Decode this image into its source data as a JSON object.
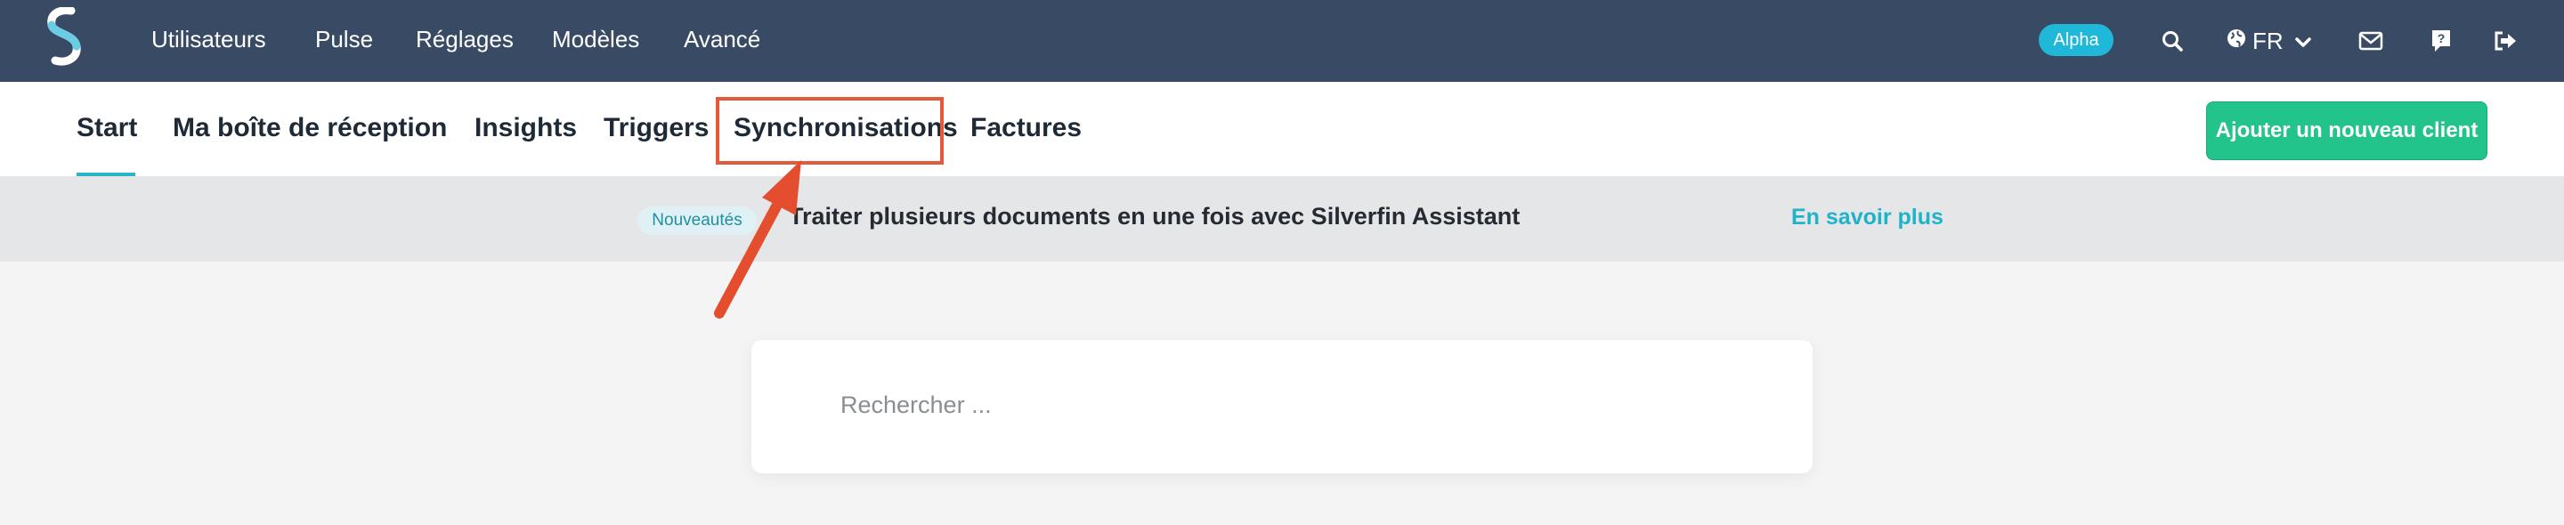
{
  "topbar": {
    "nav": [
      "Utilisateurs",
      "Pulse",
      "Réglages",
      "Modèles",
      "Avancé"
    ],
    "alpha_badge": "Alpha",
    "language": "FR",
    "icons": [
      "search-icon",
      "globe-icon",
      "chevron-down-icon",
      "mail-icon",
      "help-icon",
      "logout-icon"
    ],
    "color": "#394a64"
  },
  "subnav": {
    "tabs": [
      "Start",
      "Ma boîte de réception",
      "Insights",
      "Triggers",
      "Synchronisations",
      "Factures"
    ],
    "active_tab": "Start",
    "highlighted_tab": "Synchronisations",
    "add_client_label": "Ajouter un nouveau client",
    "accent": "#2bb3c9",
    "button_color": "#22c48b"
  },
  "announcement": {
    "badge": "Nouveautés",
    "text": "Traiter plusieurs documents en une fois avec Silverfin Assistant",
    "link": "En savoir plus"
  },
  "search": {
    "placeholder": "Rechercher ..."
  },
  "annotation": {
    "highlight_color": "#e15a3a"
  }
}
